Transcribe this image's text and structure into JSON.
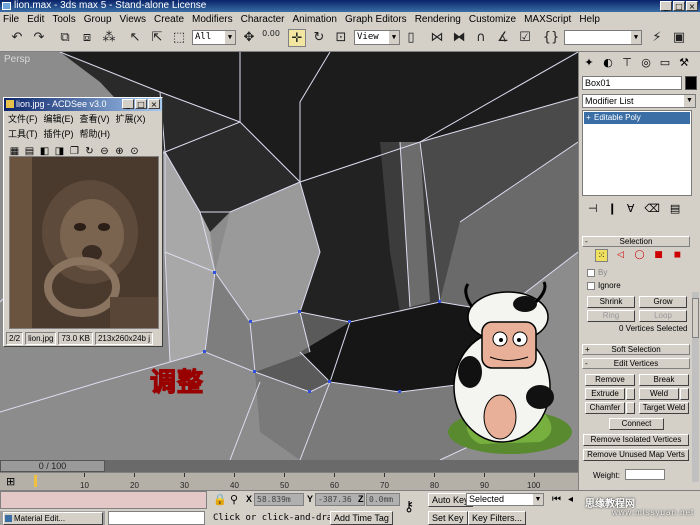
{
  "window": {
    "title": "lion.max - 3ds max 5 - Stand-alone License"
  },
  "menu": [
    "File",
    "Edit",
    "Tools",
    "Group",
    "Views",
    "Create",
    "Modifiers",
    "Character",
    "Animation",
    "Graph Editors",
    "Rendering",
    "Customize",
    "MAXScript",
    "Help"
  ],
  "toolbar": {
    "selection_filter": "All",
    "ref_coord": "View",
    "spinner_value": "0.00"
  },
  "viewport": {
    "label": "Persp"
  },
  "acdsee": {
    "title": "lion.jpg - ACDSee v3.0",
    "menu_row1": [
      "文件(F)",
      "编辑(E)",
      "查看(V)",
      "扩展(X)"
    ],
    "menu_row2": [
      "工具(T)",
      "插件(P)",
      "帮助(H)"
    ],
    "status": {
      "index": "2/2",
      "file": "lion.jpg",
      "size": "73.0 KB",
      "dims": "213x260x24b j"
    }
  },
  "overlay_text": "调整",
  "command_panel": {
    "object_name": "Box01",
    "modifier_list": "Modifier List",
    "stack_item": "Editable Poly",
    "selection": {
      "title": "Selection",
      "by_label": "By",
      "ignore_label": "Ignore",
      "shrink": "Shrink",
      "grow": "Grow",
      "ring": "Ring",
      "loop": "Loop",
      "selected_count": "0 Vertices Selected"
    },
    "soft_selection": "Soft Selection",
    "edit_vertices": {
      "title": "Edit Vertices",
      "remove": "Remove",
      "break": "Break",
      "extrude": "Extrude",
      "weld": "Weld",
      "chamfer": "Chamfer",
      "target_weld": "Target Weld",
      "connect": "Connect",
      "remove_isolated": "Remove Isolated Vertices",
      "remove_unused": "Remove Unused Map Verts",
      "weight_label": "Weight:"
    }
  },
  "timeline": {
    "frame_display": "0 / 100",
    "ticks": [
      "10",
      "20",
      "30",
      "40",
      "50",
      "60",
      "70",
      "80",
      "90",
      "100"
    ]
  },
  "status_bar": {
    "material_editor": "Material Edit...",
    "x_value": "58.839m",
    "y_value": "-387.36",
    "z_value": "0.0mm",
    "prompt": "Click or click-and-drag",
    "add_time_tag": "Add Time Tag",
    "auto_key": "Auto Key",
    "set_key": "Set Key",
    "selected": "Selected",
    "key_filters": "Key Filters..."
  },
  "watermark": {
    "line1": "思缘教程网",
    "line2": "www.missyuan.net"
  }
}
